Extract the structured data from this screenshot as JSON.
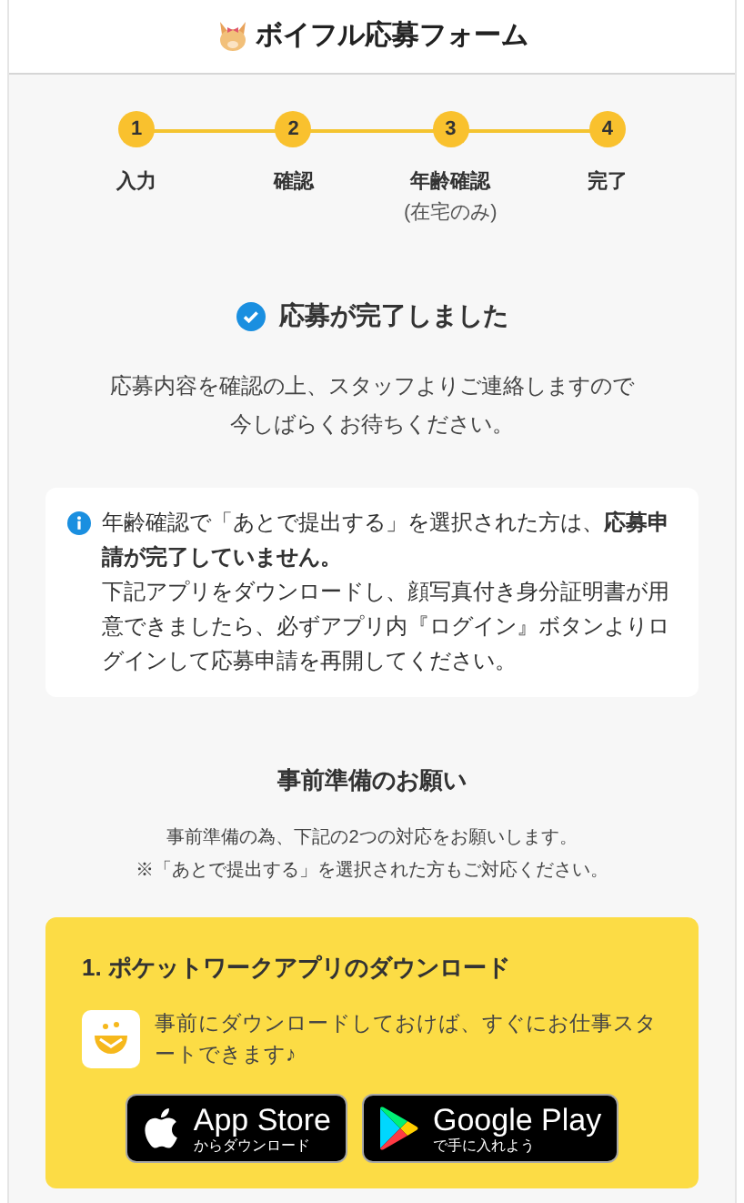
{
  "header": {
    "title": "ボイフル応募フォーム"
  },
  "steps": [
    {
      "number": "1",
      "label": "入力"
    },
    {
      "number": "2",
      "label": "確認"
    },
    {
      "number": "3",
      "label": "年齢確認",
      "note": "(在宅のみ)"
    },
    {
      "number": "4",
      "label": "完了"
    }
  ],
  "complete": {
    "title": "応募が完了しました",
    "message": [
      "応募内容を確認の上、スタッフよりご連絡しますので",
      "今しばらくお待ちください。"
    ]
  },
  "notice": {
    "lead": "年齢確認で「あとで提出する」を選択された方は、**応募申請が完了していません。**",
    "body": "下記アプリをダウンロードし、顔写真付き身分証明書が用意できましたら、必ずアプリ内『ログイン』ボタンよりログインして応募申請を再開してください。"
  },
  "preparation": {
    "title": "事前準備のお願い",
    "message": [
      "事前準備の為、下記の2つの対応をお願いします。",
      "※「あとで提出する」を選択された方もご対応ください。"
    ]
  },
  "download_card": {
    "title": "1. ポケットワークアプリのダウンロード",
    "description": "事前にダウンロードしておけば、すぐにお仕事スタートできます♪",
    "badges": [
      {
        "kind": "apple",
        "title": "App Store",
        "subtitle": "からダウンロード"
      },
      {
        "kind": "google",
        "title": "Google Play",
        "subtitle": "で手に入れよう"
      }
    ]
  }
}
